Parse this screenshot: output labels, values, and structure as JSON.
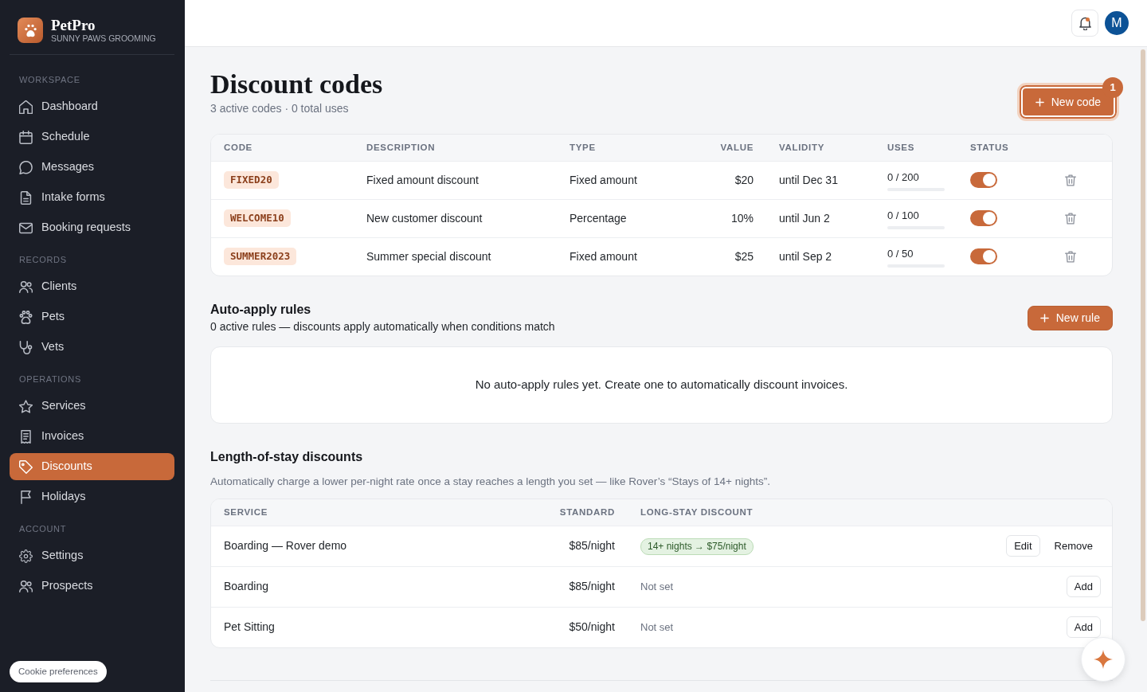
{
  "sidebar": {
    "brand": {
      "name": "PetPro",
      "tagline": "SUNNY PAWS GROOMING"
    },
    "sections": [
      {
        "label": "WORKSPACE",
        "items": [
          {
            "label": "Dashboard",
            "selected": false
          },
          {
            "label": "Schedule",
            "selected": false
          },
          {
            "label": "Messages",
            "selected": false
          },
          {
            "label": "Intake forms",
            "selected": false
          },
          {
            "label": "Booking requests",
            "selected": false
          }
        ]
      },
      {
        "label": "RECORDS",
        "items": [
          {
            "label": "Clients",
            "selected": false
          },
          {
            "label": "Pets",
            "selected": false
          },
          {
            "label": "Vets",
            "selected": false
          }
        ]
      },
      {
        "label": "OPERATIONS",
        "items": [
          {
            "label": "Services",
            "selected": false
          },
          {
            "label": "Invoices",
            "selected": false
          },
          {
            "label": "Discounts",
            "selected": true
          },
          {
            "label": "Holidays",
            "selected": false
          }
        ]
      },
      {
        "label": "ACCOUNT",
        "items": [
          {
            "label": "Settings",
            "selected": false
          },
          {
            "label": "Prospects",
            "selected": false
          }
        ]
      }
    ],
    "cookie_button": "Cookie preferences"
  },
  "header": {
    "notifications_unread": true,
    "avatar": "M"
  },
  "page": {
    "title": "Discount codes",
    "subtitle": "3 active codes · 0 total uses",
    "new_code_button": {
      "label": "New code",
      "badge": "1",
      "focused": true
    }
  },
  "codes_table": {
    "columns": [
      "CODE",
      "DESCRIPTION",
      "TYPE",
      "VALUE",
      "VALIDITY",
      "USES",
      "STATUS"
    ],
    "rows": [
      {
        "code": "FIXED20",
        "description": "Fixed amount discount",
        "type": "Fixed amount",
        "value": "$20",
        "validity": "until Dec 31",
        "uses": "0 / 200",
        "level": 0,
        "on": true
      },
      {
        "code": "WELCOME10",
        "description": "New customer discount",
        "type": "Percentage",
        "value": "10%",
        "validity": "until Jun 2",
        "uses": "0 / 100",
        "level": 0,
        "on": true
      },
      {
        "code": "SUMMER2023",
        "description": "Summer special discount",
        "type": "Fixed amount",
        "value": "$25",
        "validity": "until Sep 2",
        "uses": "0 / 50",
        "level": 0,
        "on": true
      }
    ]
  },
  "auto_apply": {
    "title": "Auto-apply rules",
    "subtitle": "0 active rules — discounts apply automatically when conditions match",
    "button": "New rule",
    "empty_text": "No auto-apply rules yet. Create one to automatically discount invoices."
  },
  "length_of_stay": {
    "title": "Length-of-stay discounts",
    "subtitle": "Automatically charge a lower per-night rate once a stay reaches a length you set — like Rover’s “Stays of 14+ nights”.",
    "columns": [
      "SERVICE",
      "STANDARD",
      "LONG-STAY DISCOUNT"
    ],
    "rows": [
      {
        "service": "Boarding — Rover demo",
        "standard": "$85/night",
        "discount": {
          "kind": "set",
          "text": "14+ nights → $75/night"
        },
        "actions": [
          {
            "label": "Edit",
            "kind": "outline"
          },
          {
            "label": "Remove",
            "kind": "plain"
          }
        ]
      },
      {
        "service": "Boarding",
        "standard": "$85/night",
        "discount": {
          "kind": "unset",
          "text": "Not set"
        },
        "actions": [
          {
            "label": "Add",
            "kind": "outline"
          }
        ]
      },
      {
        "service": "Pet Sitting",
        "standard": "$50/night",
        "discount": {
          "kind": "unset",
          "text": "Not set"
        },
        "actions": [
          {
            "label": "Add",
            "kind": "outline"
          }
        ]
      }
    ]
  }
}
